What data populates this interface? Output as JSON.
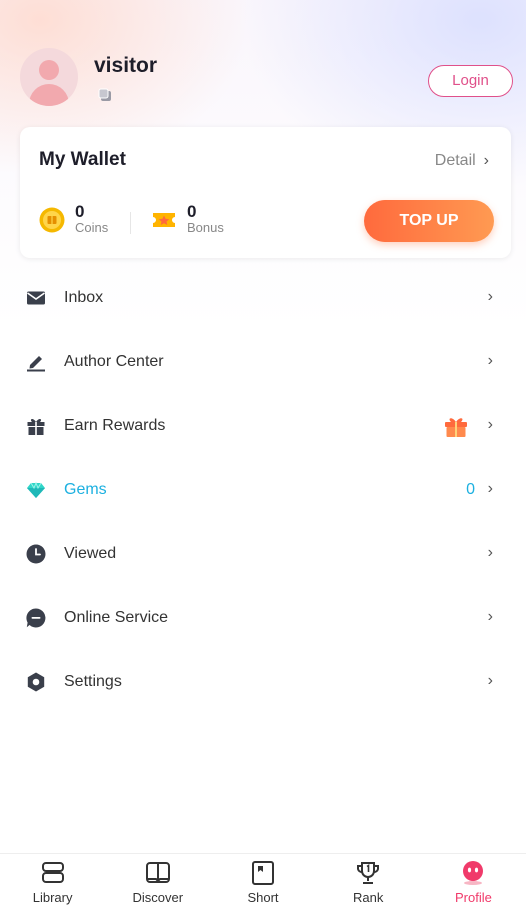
{
  "profile": {
    "username": "visitor",
    "login_label": "Login"
  },
  "wallet": {
    "title": "My Wallet",
    "detail_label": "Detail",
    "chevron": "›",
    "coins": {
      "value": "0",
      "label": "Coins"
    },
    "bonus": {
      "value": "0",
      "label": "Bonus"
    },
    "topup_label": "TOP UP"
  },
  "menu": {
    "chevron": "›",
    "items": [
      {
        "label": "Inbox",
        "icon": "mail-icon"
      },
      {
        "label": "Author Center",
        "icon": "pen-icon"
      },
      {
        "label": "Earn Rewards",
        "icon": "gift-box-icon"
      },
      {
        "label": "Gems",
        "icon": "gem-icon",
        "value": "0"
      },
      {
        "label": "Viewed",
        "icon": "clock-icon"
      },
      {
        "label": "Online Service",
        "icon": "chat-icon"
      },
      {
        "label": "Settings",
        "icon": "gear-icon"
      }
    ]
  },
  "tabs": [
    {
      "label": "Library",
      "icon": "library-icon"
    },
    {
      "label": "Discover",
      "icon": "book-icon"
    },
    {
      "label": "Short",
      "icon": "short-icon"
    },
    {
      "label": "Rank",
      "icon": "trophy-icon"
    },
    {
      "label": "Profile",
      "icon": "profile-face-icon",
      "active": true
    }
  ],
  "colors": {
    "accent": "#f03a6a",
    "login": "#e0508a",
    "topup_start": "#ff6a3d",
    "topup_end": "#ff9a52",
    "gems": "#1cb0e0",
    "coin": "#f5b800"
  }
}
